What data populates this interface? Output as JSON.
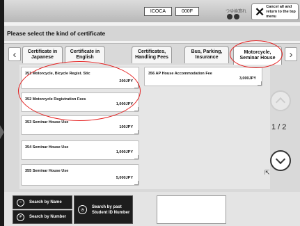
{
  "header": {
    "ic_card_label": "ICOCA",
    "balance_label": "000F",
    "jp_label": "つゆ換算れ",
    "cancel_label": "Cancel all and return to the top menu"
  },
  "page_title": "Please select the kind of certificate",
  "tabs": [
    {
      "label": "Certificate in\nJapanese",
      "active": false
    },
    {
      "label": "Certificate in\nEnglish",
      "active": false
    },
    {
      "label": "Certificates,\nHandling Fees",
      "active": false
    },
    {
      "label": "Bus, Parking,\nInsurance",
      "active": false
    },
    {
      "label": "Motorcycle,\nSeminar House",
      "active": true
    }
  ],
  "items": [
    {
      "name": "351 Motorcycle, Bicycle Regist. Stic",
      "price": "200JPY"
    },
    {
      "name": "356 AP House Accommodation Fee",
      "price": "3,000JPY"
    },
    {
      "name": "352 Motorcycle Registration Fees",
      "price": "1,000JPY"
    },
    {
      "name": "353 Seminar House Use",
      "price": "100JPY"
    },
    {
      "name": "354 Seminar House Use",
      "price": "1,000JPY"
    },
    {
      "name": "355 Seminar House Use",
      "price": "5,000JPY"
    }
  ],
  "page_indicator": "1 / 2",
  "bottom": {
    "search_name": "Search by Name",
    "search_number": "Search by Number",
    "search_past": "Search by past\nStudent ID Number"
  },
  "icons": {
    "scroll_up": "chevron-up-icon",
    "scroll_down": "chevron-down-icon",
    "cancel": "close-icon"
  },
  "colors": {
    "annotation": "#e52020"
  }
}
